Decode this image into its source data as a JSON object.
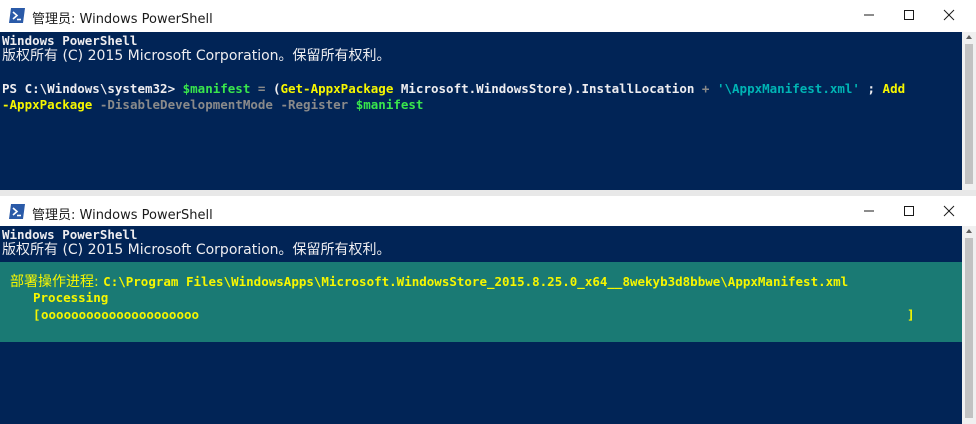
{
  "window1": {
    "title": "管理员: Windows PowerShell",
    "banner_line1": "Windows PowerShell",
    "banner_line2": "版权所有 (C) 2015 Microsoft Corporation。保留所有权利。",
    "command": {
      "prompt": "PS C:\\Windows\\system32> ",
      "var1": "$manifest",
      "eq": " = ",
      "paren_open": "(",
      "cmd1": "Get-AppxPackage",
      "arg1": " Microsoft.WindowsStore",
      "paren_close": ").InstallLocation",
      "plus": " + ",
      "string": "'\\AppxManifest.xml'",
      "semi": " ; ",
      "cmd2_part1": "Add",
      "cmd2_part2": "-AppxPackage",
      "param1": " -DisableDevelopmentMode",
      "param2": " -Register",
      "var2": " $manifest"
    }
  },
  "window2": {
    "title": "管理员: Windows PowerShell",
    "banner_line1": "Windows PowerShell",
    "banner_line2": "版权所有 (C) 2015 Microsoft Corporation。保留所有权利。",
    "progress": {
      "activity_label": "部署操作进程: ",
      "activity_path": "C:\\Program Files\\WindowsApps\\Microsoft.WindowsStore_2015.8.25.0_x64__8wekyb3d8bbwe\\AppxManifest.xml",
      "status": "Processing",
      "bar_open": "[",
      "bar_fill": "ooooooooooooooooooooo",
      "bar_close": "]",
      "percent_complete": 0.24
    }
  },
  "colors": {
    "console_bg": "#012456",
    "progress_bg": "#1a7a74",
    "text_default": "#eeedf0",
    "text_yellow": "#f6f600",
    "text_gray": "#8a8a8a",
    "text_string": "#00b4b4"
  },
  "icons": {
    "app": "powershell-icon",
    "minimize": "minimize-icon",
    "maximize": "maximize-icon",
    "close": "close-icon"
  }
}
